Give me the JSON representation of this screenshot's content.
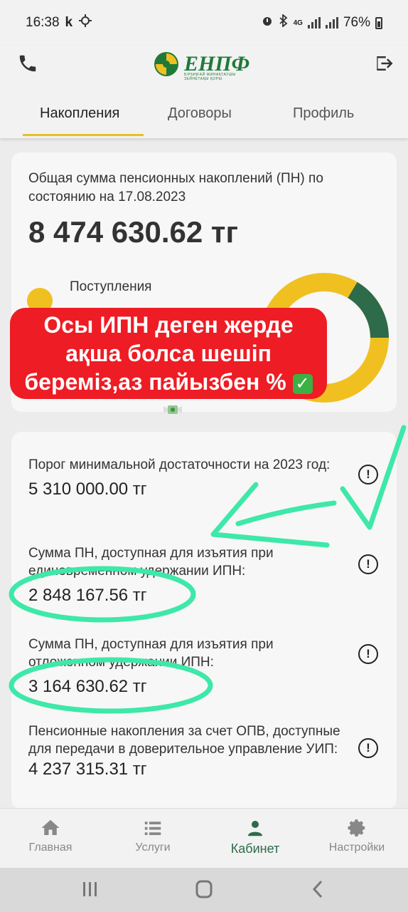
{
  "status_bar": {
    "time": "16:38",
    "app_letter": "k",
    "network": "4G",
    "battery": "76%"
  },
  "header": {
    "logo_text": "ЕНПФ",
    "logo_subtitle": "БІРЫҢҒАЙ ЖИНАҚТАУШЫ ЗЕЙНЕТАҚЫ ҚОРЫ"
  },
  "tabs": [
    {
      "label": "Накопления",
      "active": true
    },
    {
      "label": "Договоры",
      "active": false
    },
    {
      "label": "Профиль",
      "active": false
    }
  ],
  "summary": {
    "label": "Общая сумма пенсионных накоплений (ПН) по состоянию на 17.08.2023",
    "amount": "8 474 630.62 тг",
    "inflow_label": "Поступления"
  },
  "banner": {
    "line1": "Осы ИПН деген жерде",
    "line2": "ақша болса шешіп",
    "line3": "береміз,аз пайызбен % "
  },
  "details": [
    {
      "label": "Порог минимальной достаточности на 2023 год:",
      "value": "5 310 000.00 тг"
    },
    {
      "label": "Сумма ПН, доступная для изъятия при единовременном удержании ИПН:",
      "value": "2 848 167.56 тг"
    },
    {
      "label": "Сумма ПН, доступная для изъятия при отложенном удержании ИПН:",
      "value": "3 164 630.62 тг"
    },
    {
      "label": "Пенсионные накопления за счет ОПВ, доступные для передачи в доверительное управление УИП:",
      "value": "4 237 315.31 тг"
    }
  ],
  "bottom_nav": [
    {
      "label": "Главная",
      "icon": "home-icon",
      "active": false
    },
    {
      "label": "Услуги",
      "icon": "list-icon",
      "active": false
    },
    {
      "label": "Кабинет",
      "icon": "person-icon",
      "active": true
    },
    {
      "label": "Настройки",
      "icon": "gear-icon",
      "active": false
    }
  ],
  "colors": {
    "brand_green": "#2d6b4a",
    "brand_yellow": "#f0c020",
    "banner_red": "#ee1c24",
    "annotation_green": "#3ee8a8"
  }
}
